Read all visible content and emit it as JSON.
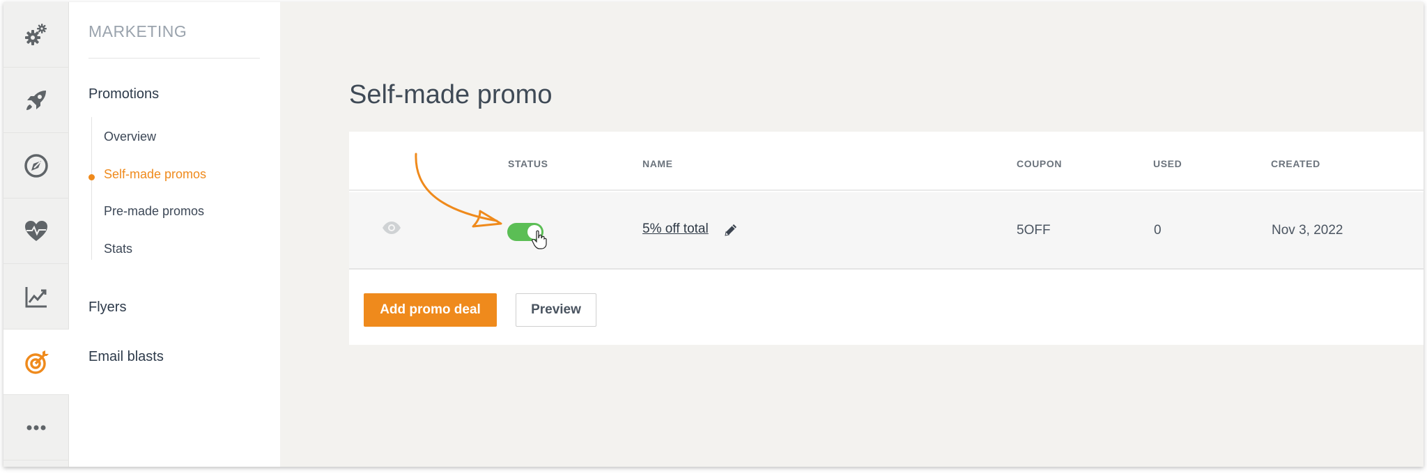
{
  "rail": {
    "items": [
      {
        "icon": "gears-icon",
        "active": false
      },
      {
        "icon": "rocket-icon",
        "active": false
      },
      {
        "icon": "compass-icon",
        "active": false
      },
      {
        "icon": "heart-pulse-icon",
        "active": false
      },
      {
        "icon": "line-chart-icon",
        "active": false
      },
      {
        "icon": "target-icon",
        "active": true
      },
      {
        "icon": "more-icon",
        "active": false
      }
    ]
  },
  "subnav": {
    "section_title": "MARKETING",
    "promotions": "Promotions",
    "items": [
      "Overview",
      "Self-made promos",
      "Pre-made promos",
      "Stats"
    ],
    "active_item": "Self-made promos",
    "flyers": "Flyers",
    "email_blasts": "Email blasts"
  },
  "main": {
    "title": "Self-made promo",
    "columns": {
      "status": "STATUS",
      "name": "NAME",
      "coupon": "COUPON",
      "used": "USED",
      "created": "CREATED"
    },
    "rows": [
      {
        "status_on": true,
        "name": "5% off total",
        "coupon": "5OFF",
        "used": "0",
        "created": "Nov 3, 2022"
      }
    ],
    "add_button": "Add promo deal",
    "preview_button": "Preview"
  },
  "colors": {
    "accent": "#ef8a1c",
    "toggle_on": "#5bbe55",
    "background": "#f3f2ef"
  }
}
